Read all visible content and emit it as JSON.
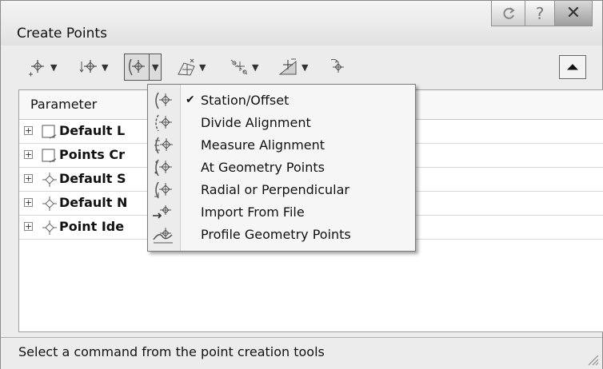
{
  "window": {
    "title": "Create Points",
    "buttons": [
      "refresh-icon",
      "help-icon",
      "close-icon"
    ],
    "help_label": "?",
    "close_label": "✕"
  },
  "toolbar": {
    "tools": [
      {
        "icon": "point-create-icon",
        "has_dropdown": true
      },
      {
        "icon": "point-intersection-icon",
        "has_dropdown": true
      },
      {
        "icon": "alignment-point-icon",
        "has_dropdown": true,
        "active": true
      },
      {
        "icon": "surface-point-icon",
        "has_dropdown": true
      },
      {
        "icon": "interpolate-point-icon",
        "has_dropdown": true
      },
      {
        "icon": "slope-point-icon",
        "has_dropdown": true
      },
      {
        "icon": "transparent-commands-icon",
        "has_dropdown": false
      }
    ],
    "collapse_label": "⏶"
  },
  "grid": {
    "column_header": "Parameter",
    "rows": [
      {
        "label": "Default L",
        "icon": "layer-icon"
      },
      {
        "label": "Points Cr",
        "icon": "layer-icon"
      },
      {
        "label": "Default S",
        "icon": "point-icon"
      },
      {
        "label": "Default N",
        "icon": "point-icon"
      },
      {
        "label": "Point Ide",
        "icon": "point-icon"
      }
    ],
    "expander": "+"
  },
  "dropdown_menu": {
    "items": [
      {
        "label": "Station/Offset",
        "checked": true
      },
      {
        "label": "Divide Alignment",
        "checked": false
      },
      {
        "label": "Measure Alignment",
        "checked": false
      },
      {
        "label": "At Geometry Points",
        "checked": false
      },
      {
        "label": "Radial or Perpendicular",
        "checked": false
      },
      {
        "label": "Import From File",
        "checked": false
      },
      {
        "label": "Profile Geometry Points",
        "checked": false
      }
    ],
    "check_mark": "✔"
  },
  "status": {
    "text": "Select a command from the point creation tools"
  }
}
